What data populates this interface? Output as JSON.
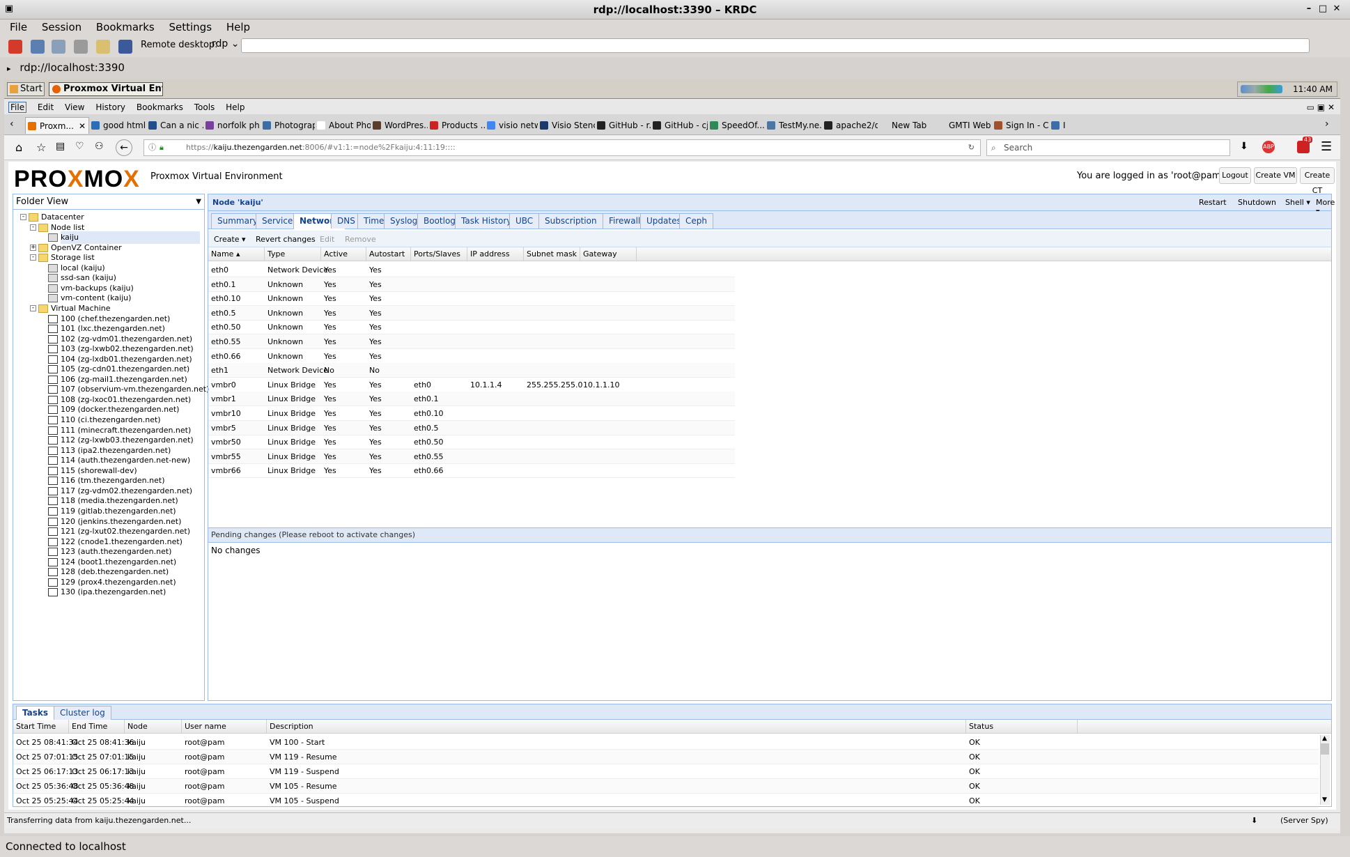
{
  "krdc": {
    "title": "rdp://localhost:3390 – KRDC",
    "menu": [
      "File",
      "Session",
      "Bookmarks",
      "Settings",
      "Help"
    ],
    "remote_desktop_label": "Remote desktop:",
    "protocol": "rdp",
    "address_value": "",
    "tab_label": "rdp://localhost:3390",
    "status": "Connected to localhost"
  },
  "remote_taskbar": {
    "start_label": "Start",
    "window_button": "Proxmox Virtual Envir...",
    "clock": "11:40 AM"
  },
  "firefox": {
    "menu": [
      "File",
      "Edit",
      "View",
      "History",
      "Bookmarks",
      "Tools",
      "Help"
    ],
    "tabs": [
      {
        "label": "Proxm...",
        "color": "#e57000"
      },
      {
        "label": "good html ...",
        "color": "#2a6ebb"
      },
      {
        "label": "Can a nic ...",
        "color": "#1f4f8a"
      },
      {
        "label": "norfolk ph...",
        "color": "#7a3f9e"
      },
      {
        "label": "Photograp...",
        "color": "#3a6ea5"
      },
      {
        "label": "About Pho...",
        "color": "#ffffff"
      },
      {
        "label": "WordPres...",
        "color": "#5a3e2b"
      },
      {
        "label": "Products ...",
        "color": "#cc2222"
      },
      {
        "label": "visio netw...",
        "color": "#4285f4"
      },
      {
        "label": "Visio Stenc...",
        "color": "#1b3a6b"
      },
      {
        "label": "GitHub - r...",
        "color": "#222222"
      },
      {
        "label": "GitHub - cj...",
        "color": "#222222"
      },
      {
        "label": "SpeedOf....",
        "color": "#2e8b57"
      },
      {
        "label": "TestMy.ne...",
        "color": "#4a76a8"
      },
      {
        "label": "apache2/d...",
        "color": "#222222"
      },
      {
        "label": "New Tab",
        "color": "#d7d7d7"
      },
      {
        "label": "GMTI Web Pro...",
        "color": "#d7d7d7"
      },
      {
        "label": "Sign In - C...",
        "color": "#a0522d"
      },
      {
        "label": "Ide",
        "color": "#3b6ea8"
      }
    ],
    "url_prefix": "https://",
    "url_host": "kaiju.thezengarden.net",
    "url_rest": ":8006/#v1:1:=node%2Fkaiju:4:11:19::::",
    "search_placeholder": "Search",
    "badge_count": "43",
    "status": "Transferring data from kaiju.thezengarden.net...",
    "status_right": "(Server Spy)"
  },
  "pve": {
    "logo_left": "PRO",
    "logo_x": "X",
    "logo_mid": "MO",
    "logo_x2": "X",
    "product": "Proxmox Virtual Environment",
    "logged_in": "You are logged in as 'root@pam'",
    "logout": "Logout",
    "create_vm": "Create VM",
    "create_ct": "Create CT",
    "view": "Folder View",
    "node_title": "Node 'kaiju'",
    "node_actions": {
      "restart": "Restart",
      "shutdown": "Shutdown",
      "shell": "Shell",
      "more": "More"
    },
    "tabs": [
      "Summary",
      "Services",
      "Network",
      "DNS",
      "Time",
      "Syslog",
      "Bootlog",
      "Task History",
      "UBC",
      "Subscription",
      "Firewall",
      "Updates",
      "Ceph"
    ],
    "active_tab": "Network",
    "net_toolbar": {
      "create": "Create",
      "revert": "Revert changes",
      "edit": "Edit",
      "remove": "Remove"
    },
    "columns": [
      "Name",
      "Type",
      "Active",
      "Autostart",
      "Ports/Slaves",
      "IP address",
      "Subnet mask",
      "Gateway"
    ],
    "rows": [
      [
        "eth0",
        "Network Device",
        "Yes",
        "Yes",
        "",
        "",
        "",
        ""
      ],
      [
        "eth0.1",
        "Unknown",
        "Yes",
        "Yes",
        "",
        "",
        "",
        ""
      ],
      [
        "eth0.10",
        "Unknown",
        "Yes",
        "Yes",
        "",
        "",
        "",
        ""
      ],
      [
        "eth0.5",
        "Unknown",
        "Yes",
        "Yes",
        "",
        "",
        "",
        ""
      ],
      [
        "eth0.50",
        "Unknown",
        "Yes",
        "Yes",
        "",
        "",
        "",
        ""
      ],
      [
        "eth0.55",
        "Unknown",
        "Yes",
        "Yes",
        "",
        "",
        "",
        ""
      ],
      [
        "eth0.66",
        "Unknown",
        "Yes",
        "Yes",
        "",
        "",
        "",
        ""
      ],
      [
        "eth1",
        "Network Device",
        "No",
        "No",
        "",
        "",
        "",
        ""
      ],
      [
        "vmbr0",
        "Linux Bridge",
        "Yes",
        "Yes",
        "eth0",
        "10.1.1.4",
        "255.255.255.0",
        "10.1.1.10"
      ],
      [
        "vmbr1",
        "Linux Bridge",
        "Yes",
        "Yes",
        "eth0.1",
        "",
        "",
        ""
      ],
      [
        "vmbr10",
        "Linux Bridge",
        "Yes",
        "Yes",
        "eth0.10",
        "",
        "",
        ""
      ],
      [
        "vmbr5",
        "Linux Bridge",
        "Yes",
        "Yes",
        "eth0.5",
        "",
        "",
        ""
      ],
      [
        "vmbr50",
        "Linux Bridge",
        "Yes",
        "Yes",
        "eth0.50",
        "",
        "",
        ""
      ],
      [
        "vmbr55",
        "Linux Bridge",
        "Yes",
        "Yes",
        "eth0.55",
        "",
        "",
        ""
      ],
      [
        "vmbr66",
        "Linux Bridge",
        "Yes",
        "Yes",
        "eth0.66",
        "",
        "",
        ""
      ]
    ],
    "pending_title": "Pending changes (Please reboot to activate changes)",
    "pending_body": "No changes",
    "tree": [
      {
        "label": "Datacenter",
        "icon": "folder",
        "level": 0,
        "expander": "-"
      },
      {
        "label": "Node list",
        "icon": "folder",
        "level": 1,
        "expander": "-"
      },
      {
        "label": "kaiju",
        "icon": "server",
        "level": 2,
        "expander": "",
        "selected": true
      },
      {
        "label": "OpenVZ Container",
        "icon": "folder",
        "level": 1,
        "expander": "+"
      },
      {
        "label": "Storage list",
        "icon": "folder",
        "level": 1,
        "expander": "-"
      },
      {
        "label": "local (kaiju)",
        "icon": "server",
        "level": 2,
        "expander": ""
      },
      {
        "label": "ssd-san (kaiju)",
        "icon": "server",
        "level": 2,
        "expander": ""
      },
      {
        "label": "vm-backups (kaiju)",
        "icon": "server",
        "level": 2,
        "expander": ""
      },
      {
        "label": "vm-content (kaiju)",
        "icon": "server",
        "level": 2,
        "expander": ""
      },
      {
        "label": "Virtual Machine",
        "icon": "folder",
        "level": 1,
        "expander": "-"
      },
      {
        "label": "100 (chef.thezengarden.net)",
        "icon": "vm",
        "level": 2,
        "expander": ""
      },
      {
        "label": "101 (lxc.thezengarden.net)",
        "icon": "vm",
        "level": 2,
        "expander": ""
      },
      {
        "label": "102 (zg-vdm01.thezengarden.net)",
        "icon": "vm",
        "level": 2,
        "expander": ""
      },
      {
        "label": "103 (zg-lxwb02.thezengarden.net)",
        "icon": "vm",
        "level": 2,
        "expander": ""
      },
      {
        "label": "104 (zg-lxdb01.thezengarden.net)",
        "icon": "vm",
        "level": 2,
        "expander": ""
      },
      {
        "label": "105 (zg-cdn01.thezengarden.net)",
        "icon": "vm",
        "level": 2,
        "expander": ""
      },
      {
        "label": "106 (zg-mail1.thezengarden.net)",
        "icon": "vm",
        "level": 2,
        "expander": ""
      },
      {
        "label": "107 (observium-vm.thezengarden.net)",
        "icon": "vm",
        "level": 2,
        "expander": ""
      },
      {
        "label": "108 (zg-lxoc01.thezengarden.net)",
        "icon": "vm",
        "level": 2,
        "expander": ""
      },
      {
        "label": "109 (docker.thezengarden.net)",
        "icon": "vm",
        "level": 2,
        "expander": ""
      },
      {
        "label": "110 (ci.thezengarden.net)",
        "icon": "vm",
        "level": 2,
        "expander": ""
      },
      {
        "label": "111 (minecraft.thezengarden.net)",
        "icon": "vm",
        "level": 2,
        "expander": ""
      },
      {
        "label": "112 (zg-lxwb03.thezengarden.net)",
        "icon": "vm",
        "level": 2,
        "expander": ""
      },
      {
        "label": "113 (ipa2.thezengarden.net)",
        "icon": "vm",
        "level": 2,
        "expander": ""
      },
      {
        "label": "114 (auth.thezengarden.net-new)",
        "icon": "vm",
        "level": 2,
        "expander": ""
      },
      {
        "label": "115 (shorewall-dev)",
        "icon": "vm",
        "level": 2,
        "expander": ""
      },
      {
        "label": "116 (tm.thezengarden.net)",
        "icon": "vm",
        "level": 2,
        "expander": ""
      },
      {
        "label": "117 (zg-vdm02.thezengarden.net)",
        "icon": "vm",
        "level": 2,
        "expander": ""
      },
      {
        "label": "118 (media.thezengarden.net)",
        "icon": "vm",
        "level": 2,
        "expander": ""
      },
      {
        "label": "119 (gitlab.thezengarden.net)",
        "icon": "vm",
        "level": 2,
        "expander": ""
      },
      {
        "label": "120 (jenkins.thezengarden.net)",
        "icon": "vm",
        "level": 2,
        "expander": ""
      },
      {
        "label": "121 (zg-lxut02.thezengarden.net)",
        "icon": "vm",
        "level": 2,
        "expander": ""
      },
      {
        "label": "122 (cnode1.thezengarden.net)",
        "icon": "vm",
        "level": 2,
        "expander": ""
      },
      {
        "label": "123 (auth.thezengarden.net)",
        "icon": "vm",
        "level": 2,
        "expander": ""
      },
      {
        "label": "124 (boot1.thezengarden.net)",
        "icon": "vm",
        "level": 2,
        "expander": ""
      },
      {
        "label": "128 (deb.thezengarden.net)",
        "icon": "vm",
        "level": 2,
        "expander": ""
      },
      {
        "label": "129 (prox4.thezengarden.net)",
        "icon": "vm",
        "level": 2,
        "expander": ""
      },
      {
        "label": "130 (ipa.thezengarden.net)",
        "icon": "vm",
        "level": 2,
        "expander": ""
      }
    ],
    "bottom_tabs": [
      "Tasks",
      "Cluster log"
    ],
    "task_columns": [
      "Start Time",
      "End Time",
      "Node",
      "User name",
      "Description",
      "Status"
    ],
    "tasks": [
      [
        "Oct 25 08:41:34",
        "Oct 25 08:41:36",
        "kaiju",
        "root@pam",
        "VM 100 - Start",
        "OK"
      ],
      [
        "Oct 25 07:01:15",
        "Oct 25 07:01:15",
        "kaiju",
        "root@pam",
        "VM 119 - Resume",
        "OK"
      ],
      [
        "Oct 25 06:17:13",
        "Oct 25 06:17:13",
        "kaiju",
        "root@pam",
        "VM 119 - Suspend",
        "OK"
      ],
      [
        "Oct 25 05:36:48",
        "Oct 25 05:36:48",
        "kaiju",
        "root@pam",
        "VM 105 - Resume",
        "OK"
      ],
      [
        "Oct 25 05:25:44",
        "Oct 25 05:25:44",
        "kaiju",
        "root@pam",
        "VM 105 - Suspend",
        "OK"
      ]
    ]
  },
  "colors": {
    "accent": "#e57000",
    "pve_blue": "#15428b",
    "panel_border": "#99bbe8",
    "header_bg": "#dfe8f6"
  }
}
